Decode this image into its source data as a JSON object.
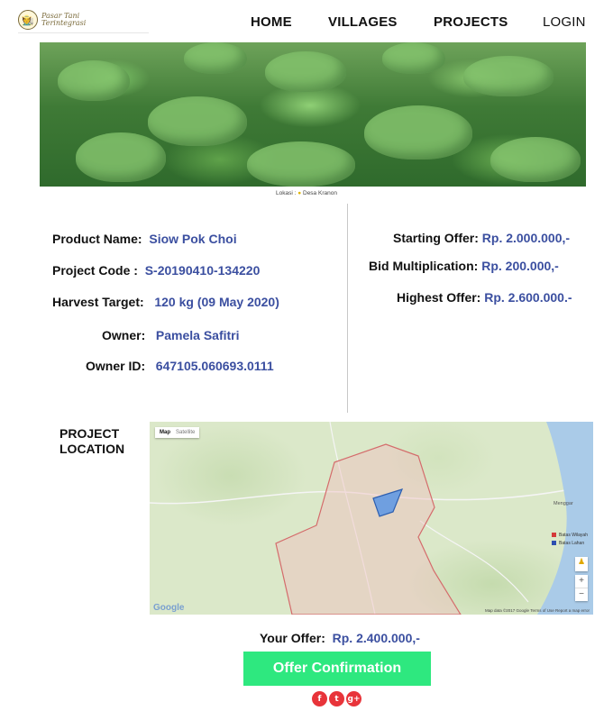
{
  "brand": {
    "line1": "Pasar Tani",
    "line2": "Terintegrasi"
  },
  "nav": {
    "home": "HOME",
    "villages": "VILLAGES",
    "projects": "PROJECTS",
    "login": "LOGIN"
  },
  "hero": {
    "caption_prefix": "Lokasi : ",
    "caption_place": "Desa Kranon"
  },
  "product": {
    "name_label": "Product Name:",
    "name_value": "Siow Pok Choi",
    "code_label": "Project Code  :",
    "code_value": "S-20190410-134220",
    "harvest_label": "Harvest Target:",
    "harvest_value": "120 kg (09 May 2020)",
    "owner_label": "Owner:",
    "owner_value": "Pamela Safitri",
    "owner_id_label": "Owner ID:",
    "owner_id_value": "647105.060693.0111"
  },
  "bid": {
    "start_label": "Starting Offer:",
    "start_value": "Rp. 2.000.000,-",
    "mult_label": "Bid Multiplication:",
    "mult_value": "Rp. 200.000,-",
    "high_label": "Highest Offer:",
    "high_value": "Rp. 2.600.000.-"
  },
  "location": {
    "label_line1": "PROJECT",
    "label_line2": "LOCATION",
    "map_type_map": "Map",
    "map_type_satellite": "Satellite",
    "legend_1": "Batas Wilayah",
    "legend_2": "Batas Lahan",
    "google": "Google",
    "attribution": "Map data ©2017 Google    Terms of Use    Report a map error",
    "town_label": "Menggar",
    "zoom_in": "+",
    "zoom_out": "−"
  },
  "offer": {
    "label": "Your Offer:",
    "value": "Rp. 2.400.000,-",
    "button": "Offer Confirmation"
  },
  "social": {
    "facebook": "f",
    "twitter": "t",
    "google_plus": "g+"
  },
  "colors": {
    "value_blue": "#3b4fa0",
    "button_green": "#2ee87f",
    "social_red": "#e8343a"
  }
}
